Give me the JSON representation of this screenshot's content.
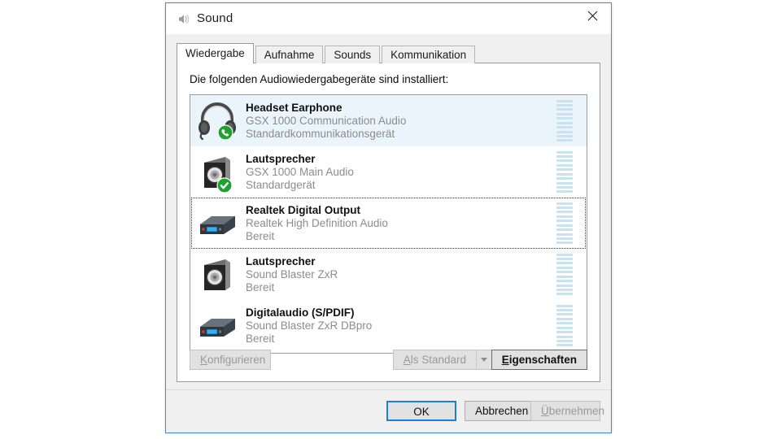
{
  "window": {
    "title": "Sound",
    "title_icon": "speaker-icon",
    "close_icon": "close-icon"
  },
  "tabs": [
    {
      "label": "Wiedergabe",
      "active": true
    },
    {
      "label": "Aufnahme",
      "active": false
    },
    {
      "label": "Sounds",
      "active": false
    },
    {
      "label": "Kommunikation",
      "active": false
    }
  ],
  "panel": {
    "hint": "Die folgenden Audiowiedergabegeräte sind installiert:"
  },
  "devices": [
    {
      "name": "Headset Earphone",
      "description": "GSX 1000 Communication Audio",
      "state": "Standardkommunikationsgerät",
      "icon": "headset-icon",
      "badge": "green-phone-badge",
      "selected": true,
      "focused": false,
      "meter_segments": 10
    },
    {
      "name": "Lautsprecher",
      "description": "GSX 1000 Main Audio",
      "state": "Standardgerät",
      "icon": "speaker-box-icon",
      "badge": "green-check-badge",
      "selected": false,
      "focused": false,
      "meter_segments": 10
    },
    {
      "name": "Realtek Digital Output",
      "description": "Realtek High Definition Audio",
      "state": "Bereit",
      "icon": "digital-output-icon",
      "badge": "none",
      "selected": false,
      "focused": true,
      "meter_segments": 10
    },
    {
      "name": "Lautsprecher",
      "description": "Sound Blaster ZxR",
      "state": "Bereit",
      "icon": "speaker-box-icon",
      "badge": "none",
      "selected": false,
      "focused": false,
      "meter_segments": 10
    },
    {
      "name": "Digitalaudio (S/PDIF)",
      "description": "Sound Blaster ZxR DBpro",
      "state": "Bereit",
      "icon": "digital-output-icon",
      "badge": "none",
      "selected": false,
      "focused": false,
      "meter_segments": 10
    }
  ],
  "actions": {
    "configure": "Konfigurieren",
    "set_default": "Als Standard",
    "set_default_caret_icon": "chevron-down-icon",
    "properties": "Eigenschaften"
  },
  "footer": {
    "ok": "OK",
    "cancel": "Abbrechen",
    "apply": "Übernehmen"
  },
  "colors": {
    "accent": "#1b7fd4",
    "selection": "#e9f4fb",
    "meter": "#c8e2ef",
    "badge_green": "#1fa12f",
    "muted_text": "#8c8c8c"
  }
}
